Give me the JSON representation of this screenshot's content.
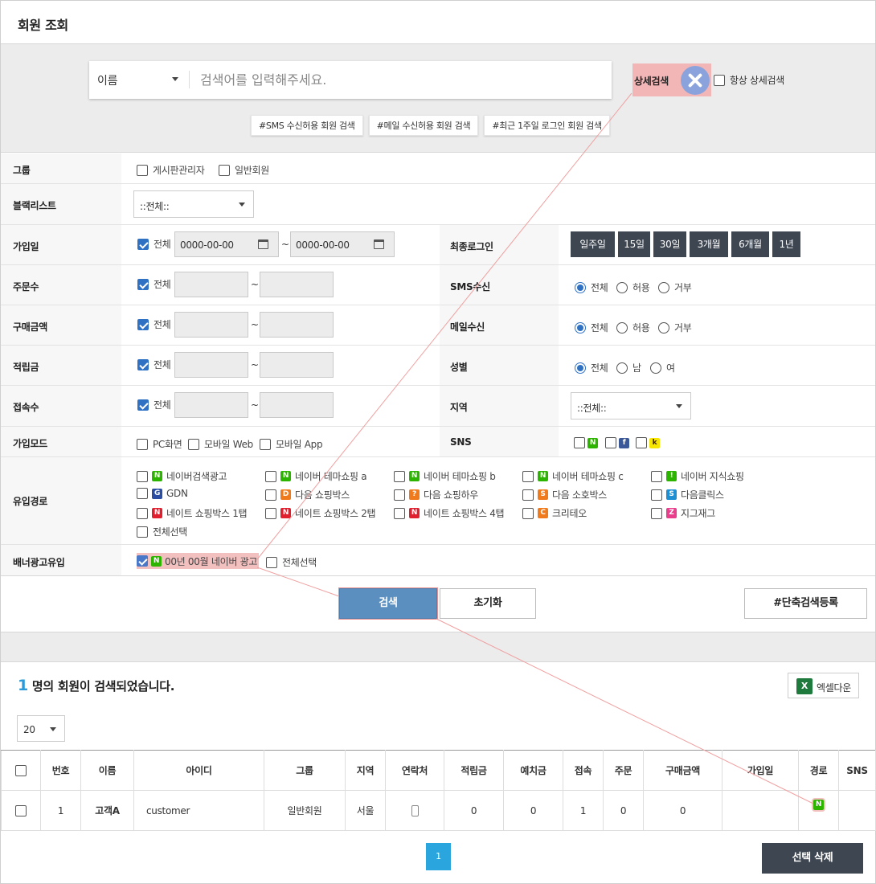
{
  "title": "회원 조회",
  "search": {
    "type_selected": "이름",
    "placeholder": "검색어를 입력해주세요.",
    "detail_label": "상세검색",
    "always_detail_label": "항상 상세검색",
    "quick_tags": [
      "#SMS 수신허용 회원 검색",
      "#메일 수신허용 회원 검색",
      "#최근 1주일 로그인 회원 검색"
    ]
  },
  "filters": {
    "group": {
      "label": "그룹",
      "options": [
        "게시판관리자",
        "일반회원"
      ]
    },
    "blacklist": {
      "label": "블랙리스트",
      "selected": "::전체::"
    },
    "join_date": {
      "label": "가입일",
      "all_label": "전체",
      "from": "0000-00-00",
      "to": "0000-00-00",
      "tilde": "~"
    },
    "last_login": {
      "label": "최종로그인",
      "periods": [
        "일주일",
        "15일",
        "30일",
        "3개월",
        "6개월",
        "1년"
      ]
    },
    "order_count": {
      "label": "주문수",
      "all_label": "전체"
    },
    "sms": {
      "label": "SMS수신",
      "options": [
        "전체",
        "허용",
        "거부"
      ],
      "selected": "전체"
    },
    "purchase": {
      "label": "구매금액",
      "all_label": "전체"
    },
    "mail": {
      "label": "메일수신",
      "options": [
        "전체",
        "허용",
        "거부"
      ],
      "selected": "전체"
    },
    "points": {
      "label": "적립금",
      "all_label": "전체"
    },
    "gender": {
      "label": "성별",
      "options": [
        "전체",
        "남",
        "여"
      ],
      "selected": "전체"
    },
    "visits": {
      "label": "접속수",
      "all_label": "전체"
    },
    "region": {
      "label": "지역",
      "selected": "::전체::"
    },
    "join_mode": {
      "label": "가입모드",
      "options": [
        "PC화면",
        "모바일 Web",
        "모바일 App"
      ]
    },
    "sns": {
      "label": "SNS",
      "icons": [
        "N",
        "f",
        "k"
      ]
    },
    "inflow": {
      "label": "유입경로",
      "items": [
        {
          "icon": "N",
          "color": "#2db400",
          "label": "네이버검색광고"
        },
        {
          "icon": "N",
          "color": "#2db400",
          "label": "네이버 테마쇼핑 a"
        },
        {
          "icon": "N",
          "color": "#2db400",
          "label": "네이버 테마쇼핑 b"
        },
        {
          "icon": "N",
          "color": "#2db400",
          "label": "네이버 테마쇼핑 c"
        },
        {
          "icon": "!",
          "color": "#2db400",
          "label": "네이버 지식쇼핑"
        },
        {
          "icon": "G",
          "color": "#2b4ea2",
          "label": "GDN"
        },
        {
          "icon": "D",
          "color": "#f07b1d",
          "label": "다음 쇼핑박스"
        },
        {
          "icon": "?",
          "color": "#f07b1d",
          "label": "다음 쇼핑하우"
        },
        {
          "icon": "S",
          "color": "#f07b1d",
          "label": "다음 소호박스"
        },
        {
          "icon": "S",
          "color": "#1f8fd1",
          "label": "다음클릭스"
        },
        {
          "icon": "N",
          "color": "#e0202f",
          "label": "네이트 쇼핑박스 1탭"
        },
        {
          "icon": "N",
          "color": "#e0202f",
          "label": "네이트 쇼핑박스 2탭"
        },
        {
          "icon": "N",
          "color": "#e0202f",
          "label": "네이트 쇼핑박스 4탭"
        },
        {
          "icon": "C",
          "color": "#f07b1d",
          "label": "크리테오"
        },
        {
          "icon": "Z",
          "color": "#e83e8c",
          "label": "지그재그"
        }
      ],
      "select_all": "전체선택"
    },
    "banner": {
      "label": "배너광고유입",
      "item": "00년 00월 네이버 광고",
      "select_all": "전체선택"
    }
  },
  "buttons": {
    "search": "검색",
    "reset": "초기화",
    "shortcut": "#단축검색등록",
    "excel": "엑셀다운",
    "delete": "선택 삭제"
  },
  "result": {
    "count": "1",
    "text": "명의 회원이 검색되었습니다."
  },
  "page_size": "20",
  "table": {
    "headers": [
      "",
      "번호",
      "이름",
      "아이디",
      "그룹",
      "지역",
      "연락처",
      "적립금",
      "예치금",
      "접속",
      "주문",
      "구매금액",
      "가입일",
      "경로",
      "SNS"
    ],
    "rows": [
      {
        "no": "1",
        "name": "고객A",
        "id": "customer",
        "group": "일반회원",
        "region": "서울",
        "points": "0",
        "deposit": "0",
        "visits": "1",
        "orders": "0",
        "purchase": "0",
        "joined": "",
        "route": "N"
      }
    ]
  },
  "pagination": {
    "current": "1"
  },
  "colors": {
    "accent": "#2aa5de",
    "dark_button": "#3e4652",
    "search_button": "#5a8fc0",
    "highlight": "#f3c0c0"
  }
}
